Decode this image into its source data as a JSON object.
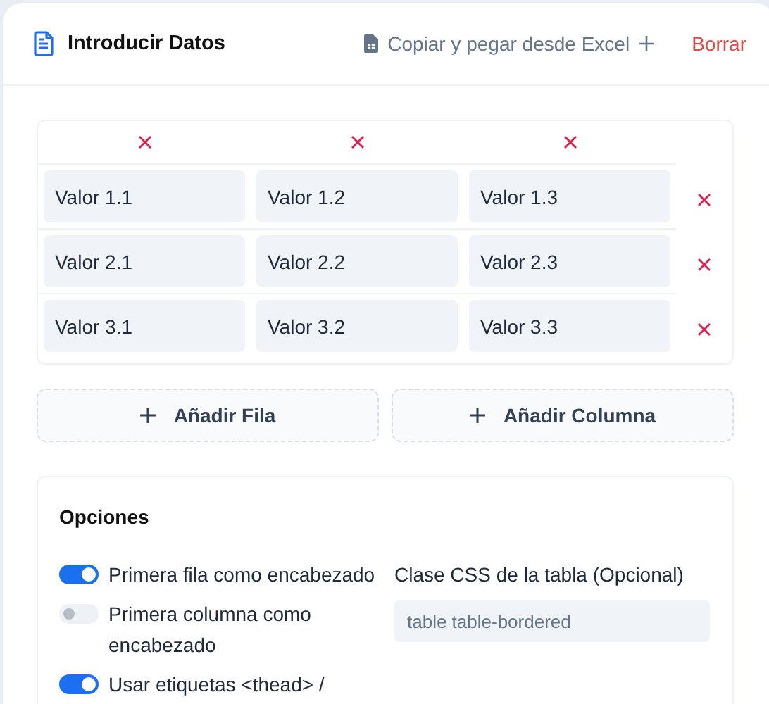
{
  "header": {
    "title": "Introducir Datos",
    "paste_button": "Copiar y pegar desde Excel",
    "clear_button": "Borrar"
  },
  "table": {
    "rows": [
      [
        "Valor 1.1",
        "Valor 1.2",
        "Valor 1.3"
      ],
      [
        "Valor 2.1",
        "Valor 2.2",
        "Valor 2.3"
      ],
      [
        "Valor 3.1",
        "Valor 3.2",
        "Valor 3.3"
      ]
    ]
  },
  "actions": [
    "Añadir Fila",
    "Añadir Columna"
  ],
  "options": {
    "title": "Opciones",
    "toggles": [
      {
        "label": "Primera fila como encabezado",
        "on": true
      },
      {
        "label": "Primera columna como encabezado",
        "on": false
      },
      {
        "label": "Usar etiquetas <thead> /",
        "on": true
      }
    ],
    "css_class": {
      "label": "Clase CSS de la tabla (Opcional)",
      "placeholder": "table table-bordered"
    }
  }
}
